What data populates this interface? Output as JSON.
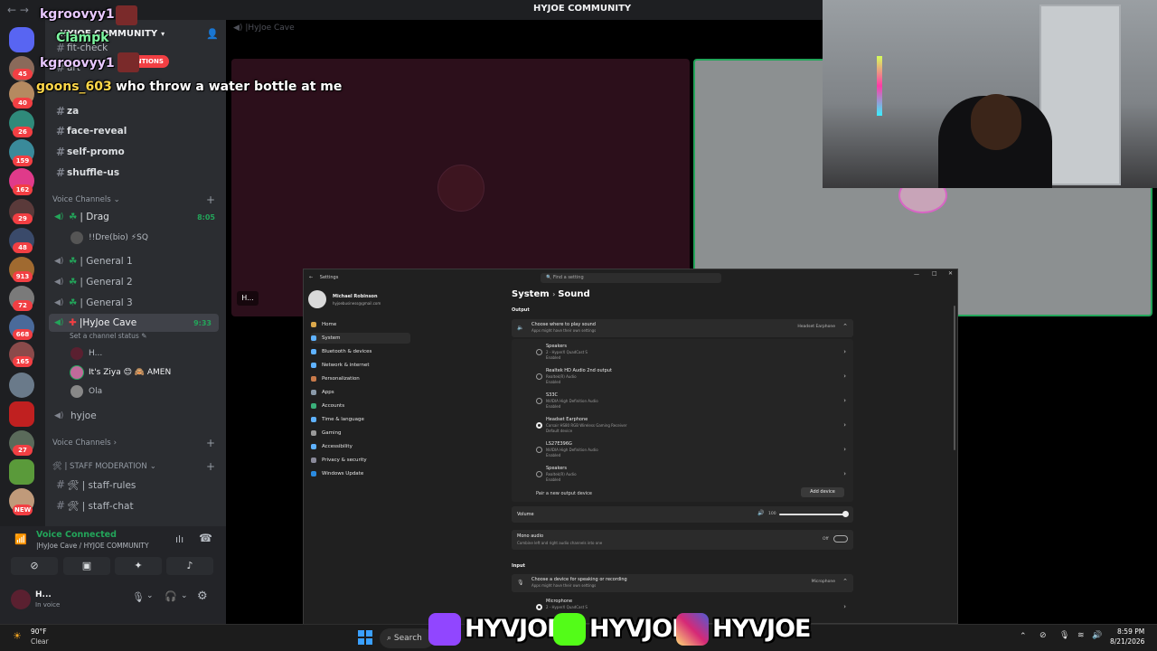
{
  "titlebar": {
    "title": "HYJOE COMMUNITY",
    "nav": "←  →"
  },
  "server": {
    "name": "HYJOE COMMUNITY"
  },
  "channels": {
    "partial_top": [
      "fit-check",
      "art"
    ],
    "mention_pill": "ENTIONS",
    "text": [
      {
        "name": "za"
      },
      {
        "name": "face-reveal"
      },
      {
        "name": "self-promo"
      },
      {
        "name": "shuffle-us"
      }
    ],
    "voice_category": "Voice Channels",
    "voice": [
      {
        "name": "| Drag",
        "time": "8:05"
      },
      {
        "name": "| General 1"
      },
      {
        "name": "| General 2"
      },
      {
        "name": "| General 3"
      },
      {
        "name": "|HyJoe Cave",
        "time": "9:33"
      }
    ],
    "drag_member": "!!Dre(bio) ⚡SQ",
    "cave_status": "Set a channel status",
    "cave_members": [
      {
        "name": "H..."
      },
      {
        "name": "It's Ziya 😊 🙈 AMEN"
      },
      {
        "name": "Ola"
      }
    ],
    "hyjoe": "hyjoe",
    "voice_category2": "Voice Channels",
    "staff_category": "🛠 | STAFF MODERATION",
    "staff": [
      {
        "name": "🛠 | staff-rules"
      },
      {
        "name": "🛠 | staff-chat"
      }
    ]
  },
  "rail_badges": [
    "45",
    "40",
    "26",
    "159",
    "162",
    "29",
    "48",
    "913",
    "72",
    "668",
    "165",
    "27",
    "NEW"
  ],
  "voice_panel": {
    "status": "Voice Connected",
    "location": "|HyJoe Cave / HYJOE COMMUNITY",
    "user_name": "H...",
    "user_status": "In voice"
  },
  "main": {
    "header": "|HyJoe Cave",
    "tile1_label": "H..."
  },
  "overlay_chat": [
    {
      "user": "kgroovyy1",
      "msg": ""
    },
    {
      "user": "Clampk",
      "msg": ""
    },
    {
      "user": "kgroovyy1",
      "msg": ""
    },
    {
      "user": "goons_603",
      "msg": "who throw a water bottle at me"
    }
  ],
  "settings": {
    "app": "Settings",
    "search_placeholder": "Find a setting",
    "user_name": "Michael Robinson",
    "user_email": "hyjoebusiness@gmail.com",
    "breadcrumb_parent": "System",
    "breadcrumb_current": "Sound",
    "nav": [
      "Home",
      "System",
      "Bluetooth & devices",
      "Network & internet",
      "Personalization",
      "Apps",
      "Accounts",
      "Time & language",
      "Gaming",
      "Accessibility",
      "Privacy & security",
      "Windows Update"
    ],
    "output_label": "Output",
    "choose_output": "Choose where to play sound",
    "choose_output_sub": "Apps might have their own settings",
    "output_selected": "Headset Earphone",
    "devices": [
      {
        "name": "Speakers",
        "d1": "2 - HyperX QuadCast S",
        "d2": "Enabled"
      },
      {
        "name": "Realtek HD Audio 2nd output",
        "d1": "Realtek(R) Audio",
        "d2": "Enabled"
      },
      {
        "name": "S33C",
        "d1": "NVIDIA High Definition Audio",
        "d2": "Enabled"
      },
      {
        "name": "Headset Earphone",
        "d1": "Corsair HS80 RGB Wireless Gaming Receiver",
        "d2": "Default device"
      },
      {
        "name": "LS27E396G",
        "d1": "NVIDIA High Definition Audio",
        "d2": "Enabled"
      },
      {
        "name": "Speakers",
        "d1": "Realtek(R) Audio",
        "d2": "Enabled"
      }
    ],
    "pair_new": "Pair a new output device",
    "add_device": "Add device",
    "volume_label": "Volume",
    "volume_value": "100",
    "mono_audio": "Mono audio",
    "mono_sub": "Combine left and right audio channels into one",
    "mono_state": "Off",
    "input_label": "Input",
    "choose_input": "Choose a device for speaking or recording",
    "choose_input_sub": "Apps might have their own settings",
    "input_selected": "Microphone",
    "input_device": "Microphone",
    "input_device_sub": "2 - HyperX QuadCast S"
  },
  "social": {
    "handle1": "HYVJOE",
    "handle2": "HYVJOE",
    "handle3": "HYVJOE"
  },
  "taskbar": {
    "temp": "90°F",
    "weather": "Clear",
    "search": "Search",
    "time": "8:59 PM",
    "date": "8/21/2026"
  },
  "colors": {
    "discord_green": "#23a55a",
    "mention_red": "#f23f43",
    "twitch": "#9146ff",
    "kick": "#53fc18"
  }
}
